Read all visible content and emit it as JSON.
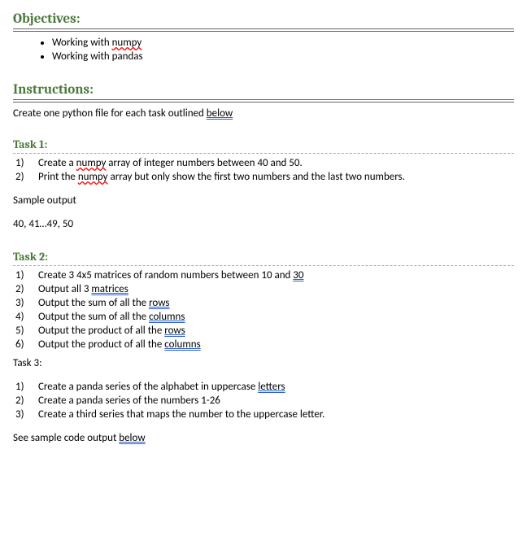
{
  "sections": {
    "objectives": {
      "heading": "Objectives:",
      "items": [
        {
          "pre": "Working with ",
          "err": "numpy",
          "errType": "spell",
          "post": ""
        },
        {
          "pre": "Working with pandas",
          "err": "",
          "errType": "",
          "post": ""
        }
      ]
    },
    "instructions": {
      "heading": "Instructions:",
      "line_pre": "Create one python file for each task outlined ",
      "line_err": "below",
      "line_errType": "grammar"
    },
    "task1": {
      "heading": "Task 1:",
      "items": [
        {
          "n": "1)",
          "pre": "Create a ",
          "err": "numpy",
          "errType": "spell",
          "post": " array of integer numbers between 40 and 50."
        },
        {
          "n": "2)",
          "pre": "Print the ",
          "err": "numpy",
          "errType": "spell",
          "post": " array but only show the first two numbers and the last two numbers."
        }
      ],
      "sample_label": "Sample output",
      "sample_output": "40, 41…49, 50"
    },
    "task2": {
      "heading": "Task 2:",
      "items": [
        {
          "n": "1)",
          "pre": "Create 3 4x5 matrices of random numbers between 10 and ",
          "err": "30",
          "errType": "grammar",
          "post": ""
        },
        {
          "n": "2)",
          "pre": "Output all 3 ",
          "err": "matrices",
          "errType": "grammar",
          "post": ""
        },
        {
          "n": "3)",
          "pre": "Output the sum of all the ",
          "err": "rows",
          "errType": "grammar",
          "post": ""
        },
        {
          "n": "4)",
          "pre": "Output the sum of all the ",
          "err": "columns",
          "errType": "grammar",
          "post": ""
        },
        {
          "n": "5)",
          "pre": "Output the product of all the ",
          "err": "rows",
          "errType": "grammar",
          "post": ""
        },
        {
          "n": "6)",
          "pre": "Output the product of all the ",
          "err": "columns",
          "errType": "grammar",
          "post": ""
        }
      ]
    },
    "task3": {
      "heading": "Task 3:",
      "items": [
        {
          "n": "1)",
          "pre": "Create a panda series of the alphabet in uppercase ",
          "err": "letters",
          "errType": "grammar",
          "post": ""
        },
        {
          "n": "2)",
          "pre": "Create a panda series of the numbers 1-26",
          "err": "",
          "errType": "",
          "post": ""
        },
        {
          "n": "3)",
          "pre": "Create a third series that maps the number to the uppercase letter.",
          "err": "",
          "errType": "",
          "post": ""
        }
      ],
      "footer_pre": "See sample code output ",
      "footer_err": "below",
      "footer_errType": "grammar"
    }
  }
}
